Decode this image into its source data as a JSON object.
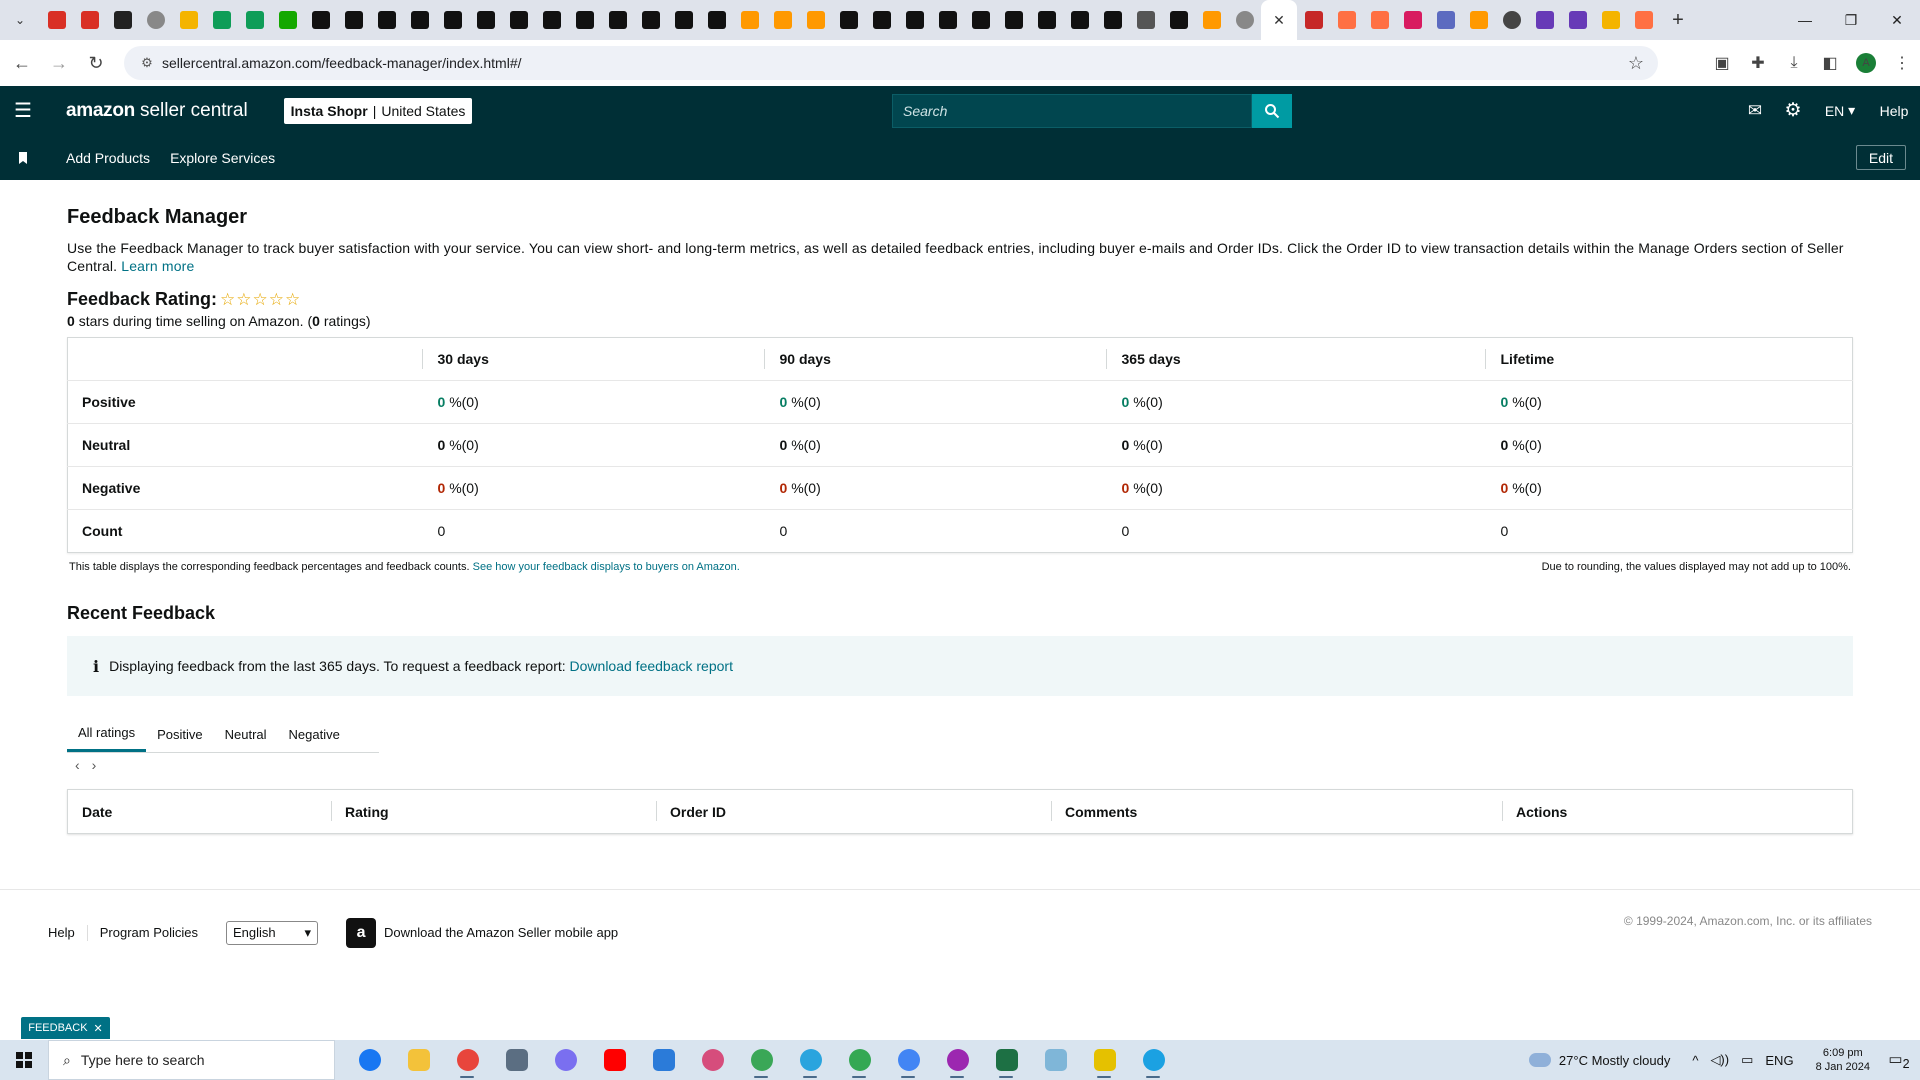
{
  "browser": {
    "url": "sellercentral.amazon.com/feedback-manager/index.html#/",
    "tab_favicons": [
      "gmail-icon",
      "gmail-icon",
      "wix-icon",
      "globe-icon",
      "google-drive-icon",
      "google-sheets-icon",
      "google-sheets-icon",
      "upwork-icon",
      "amazon-icon",
      "amazon-icon",
      "amazon-icon",
      "amazon-icon",
      "amazon-icon",
      "amazon-icon",
      "amazon-icon",
      "amazon-icon",
      "amazon-icon",
      "amazon-icon",
      "amazon-icon",
      "amazon-icon",
      "amazon-icon",
      "amazon-smile-icon",
      "amazon-smile-icon",
      "amazon-smile-icon",
      "amazon-icon",
      "amazon-icon",
      "amazon-icon",
      "amazon-icon",
      "amazon-icon",
      "amazon-icon",
      "amazon-icon",
      "amazon-icon",
      "amazon-icon",
      "gt-icon",
      "amazon-icon",
      "amazon-smile-icon",
      "globe-icon"
    ],
    "tab_favicons_after": [
      "vpn-icon",
      "pencil-icon",
      "pencil-icon",
      "ahrefs-icon",
      "cloud-icon",
      "amazon-smile-icon",
      "chatgpt-icon",
      "forms-icon",
      "forms-icon",
      "google-drive-icon",
      "pencil-icon"
    ],
    "active_tab_close": "✕",
    "new_tab": "+"
  },
  "header": {
    "logo_amazon": "amazon",
    "logo_rest": "seller central",
    "store_name": "Insta Shopr",
    "store_region": "United States",
    "search_placeholder": "Search",
    "lang": "EN",
    "help": "Help"
  },
  "subnav": {
    "items": [
      "Add Products",
      "Explore Services"
    ],
    "edit": "Edit"
  },
  "page": {
    "title": "Feedback Manager",
    "description": "Use the Feedback Manager to track buyer satisfaction with your service. You can view short- and long-term metrics, as well as detailed feedback entries, including buyer e-mails and Order IDs. Click the Order ID to view transaction details within the Manage Orders section of Seller Central.",
    "learn_more": "Learn more",
    "rating_label": "Feedback Rating:",
    "stars": 0,
    "stars_sub_count": "0",
    "stars_sub_text": "stars during time selling on Amazon. (",
    "ratings_count": "0",
    "ratings_text": "ratings)"
  },
  "metrics": {
    "columns": [
      "30 days",
      "90 days",
      "365 days",
      "Lifetime"
    ],
    "rows": [
      {
        "label": "Positive",
        "kind": "green",
        "cells": [
          [
            "0",
            "%(0)"
          ],
          [
            "0",
            "%(0)"
          ],
          [
            "0",
            "%(0)"
          ],
          [
            "0",
            "%(0)"
          ]
        ]
      },
      {
        "label": "Neutral",
        "kind": "dark",
        "cells": [
          [
            "0",
            "%(0)"
          ],
          [
            "0",
            "%(0)"
          ],
          [
            "0",
            "%(0)"
          ],
          [
            "0",
            "%(0)"
          ]
        ]
      },
      {
        "label": "Negative",
        "kind": "red",
        "cells": [
          [
            "0",
            "%(0)"
          ],
          [
            "0",
            "%(0)"
          ],
          [
            "0",
            "%(0)"
          ],
          [
            "0",
            "%(0)"
          ]
        ]
      },
      {
        "label": "Count",
        "kind": "plain",
        "cells": [
          [
            "",
            "0"
          ],
          [
            "",
            "0"
          ],
          [
            "",
            "0"
          ],
          [
            "",
            "0"
          ]
        ]
      }
    ],
    "note_left": "This table displays the corresponding feedback percentages and feedback counts.",
    "note_link": "See how your feedback displays to buyers on Amazon.",
    "note_right": "Due to rounding, the values displayed may not add up to 100%."
  },
  "recent": {
    "title": "Recent Feedback",
    "info_text": "Displaying feedback from the last 365 days. To request a feedback report:",
    "info_link": "Download feedback report",
    "tabs": [
      "All ratings",
      "Positive",
      "Neutral",
      "Negative"
    ],
    "active_tab": "All ratings",
    "columns": [
      "Date",
      "Rating",
      "Order ID",
      "Comments",
      "Actions"
    ]
  },
  "footer": {
    "links": [
      "Help",
      "Program Policies"
    ],
    "language": "English",
    "app_text": "Download the Amazon Seller mobile app",
    "copyright": "© 1999-2024, Amazon.com, Inc. or its affiliates",
    "feedback_tag": "FEEDBACK"
  },
  "taskbar": {
    "search_placeholder": "Type here to search",
    "weather": "27°C  Mostly cloudy",
    "lang": "ENG",
    "time": "6:09 pm",
    "date": "8 Jan 2024",
    "notifications": "2"
  },
  "colors": {
    "header_bg": "#002f36",
    "search_btn": "#009ba3",
    "link": "#007185",
    "positive": "#067d62",
    "negative": "#b12704"
  }
}
